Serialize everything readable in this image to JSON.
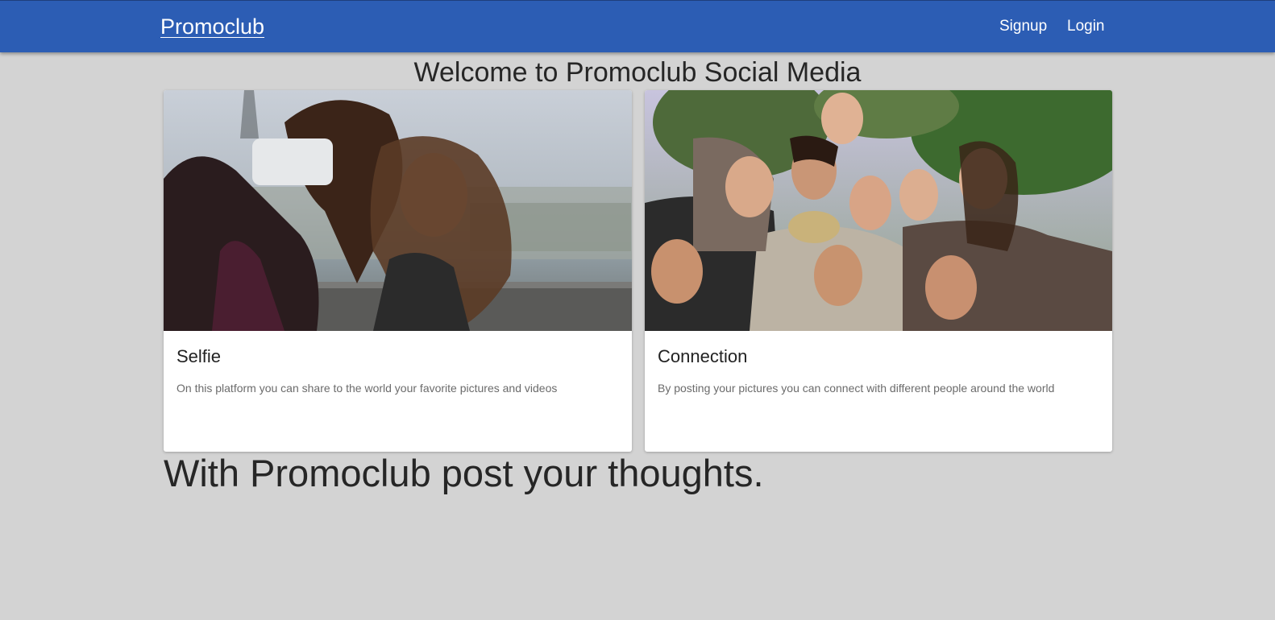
{
  "nav": {
    "brand": "Promoclub",
    "links": [
      {
        "label": "Signup"
      },
      {
        "label": "Login"
      }
    ]
  },
  "colors": {
    "navbar": "#2c5db4",
    "background": "#d3d3d3",
    "card": "#ffffff"
  },
  "welcome": "Welcome to Promoclub Social Media",
  "cards": [
    {
      "title": "Selfie",
      "text": "On this platform you can share to the world your favorite pictures and videos",
      "image": "selfie-photo"
    },
    {
      "title": "Connection",
      "text": "By posting your pictures you can connect with different people around the world",
      "image": "group-of-friends-photo"
    }
  ],
  "tagline": "With Promoclub post your thoughts."
}
